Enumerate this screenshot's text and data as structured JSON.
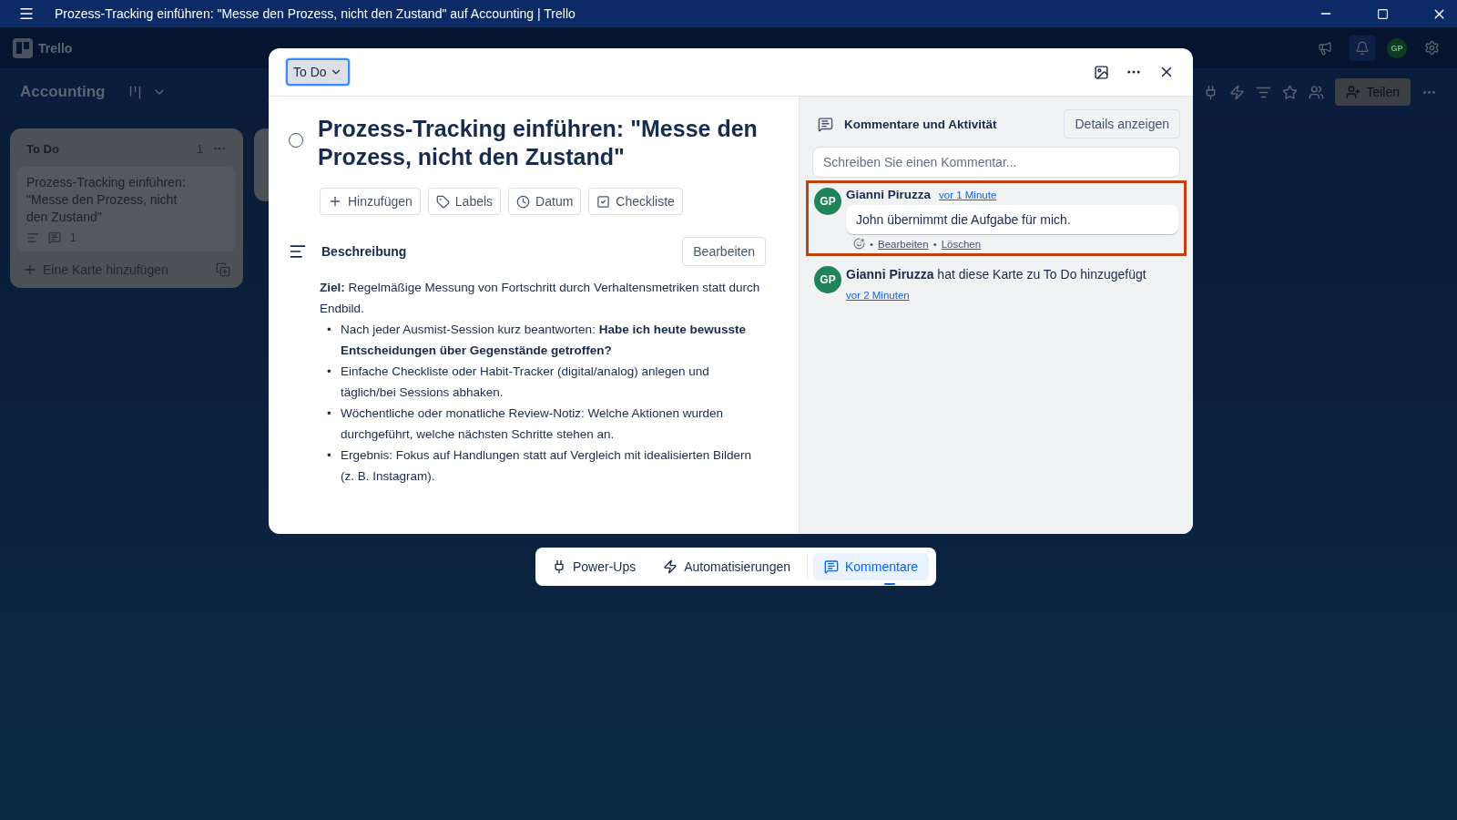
{
  "window": {
    "title": "Prozess-Tracking einführen: \"Messe den Prozess, nicht den Zustand\" auf Accounting | Trello"
  },
  "app_header": {
    "logo": "Trello",
    "avatar": "GP"
  },
  "board": {
    "name": "Accounting",
    "share_button": "Teilen"
  },
  "lists": [
    {
      "title": "To Do",
      "count": "1",
      "cards": [
        {
          "title": "Prozess-Tracking einführen: \"Messe den Prozess, nicht den Zustand\"",
          "comment_count": "1"
        }
      ],
      "add_card": "Eine Karte hinzufügen"
    }
  ],
  "card_modal": {
    "list_button": "To Do",
    "title": "Prozess-Tracking einführen: \"Messe den Prozess, nicht den Zustand\"",
    "completed": false,
    "actions": [
      {
        "kind": "add",
        "label": "Hinzufügen"
      },
      {
        "kind": "labels",
        "label": "Labels"
      },
      {
        "kind": "date",
        "label": "Datum"
      },
      {
        "kind": "checklist",
        "label": "Checkliste"
      }
    ],
    "description": {
      "heading": "Beschreibung",
      "edit_button": "Bearbeiten",
      "goal": "**Ziel:** Regelmäßige Messung von Fortschritt durch Verhaltensmetriken statt durch Endbild.",
      "bullets": [
        {
          "marker": "•",
          "text": "Nach jeder Ausmist-Session kurz beantworten: **Habe ich heute bewusste Entscheidungen über Gegenstände getroffen?**"
        },
        {
          "marker": "•",
          "text": "Einfache Checkliste oder Habit-Tracker (digital/analog) anlegen und täglich/bei Sessions abhaken."
        },
        {
          "marker": "•",
          "text": "Wöchentliche oder monatliche Review-Notiz: Welche Aktionen wurden durchgeführt, welche nächsten Schritte stehen an."
        },
        {
          "marker": "•",
          "text": "Ergebnis: Fokus auf Handlungen statt auf Vergleich mit idealisierten Bildern (z. B. Instagram)."
        }
      ]
    },
    "activity": {
      "heading": "Kommentare und Aktivität",
      "details_button": "Details anzeigen",
      "comment_placeholder": "Schreiben Sie einen Kommentar...",
      "items": [
        {
          "kind": "comment",
          "initials": "GP",
          "color": "#1f845a",
          "author": "Gianni Piruzza",
          "time": "vor 1 Minute",
          "text": "John übernimmt die Aufgabe für mich.",
          "actions": [
            {
              "separator": "•",
              "label": "Bearbeiten"
            },
            {
              "separator": "•",
              "label": "Löschen"
            }
          ],
          "highlighted": true
        },
        {
          "kind": "event",
          "initials": "GP",
          "color": "#1f845a",
          "text": "**Gianni Piruzza** hat diese Karte zu To Do hinzugefügt",
          "time": "vor 2 Minuten",
          "highlighted": false
        }
      ]
    }
  },
  "bottom_bar": [
    {
      "kind": "power-ups",
      "label": "Power-Ups",
      "selected": false
    },
    {
      "kind": "automation",
      "label": "Automatisierungen",
      "selected": false
    },
    {
      "kind": "comments",
      "label": "Kommentare",
      "selected": true
    }
  ]
}
